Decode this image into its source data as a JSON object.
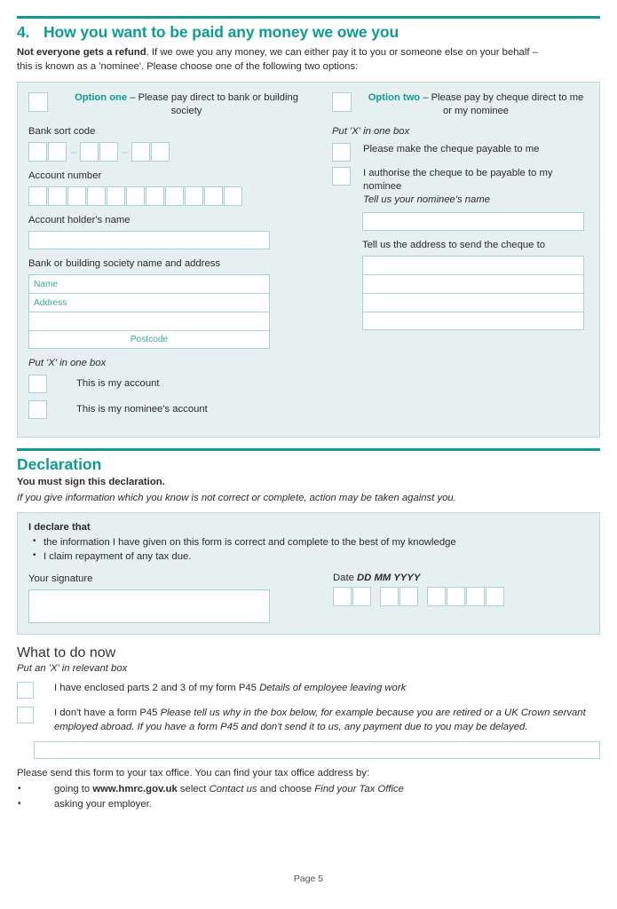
{
  "section4": {
    "number": "4.",
    "title": "How you want to be paid any money we owe you",
    "intro_bold": "Not everyone gets a refund",
    "intro_rest": ". If we owe you any money, we can either pay it to you or someone else on your behalf – this is known as a 'nominee'. Please choose one of the following two options:",
    "option_one": {
      "name": "Option one",
      "desc": "– Please pay direct to bank or building society",
      "sort_code_label": "Bank sort code",
      "sort_code_boxes": 6,
      "sort_code_separator": "–",
      "account_number_label": "Account number",
      "account_number_boxes": 11,
      "account_holder_label": "Account holder's name",
      "bank_address_label": "Bank or building society name and address",
      "bank_address_rows": [
        "Name",
        "Address",
        "",
        "Postcode"
      ],
      "put_x_label": "Put 'X' in one box",
      "checkbox_my_account": "This is my account",
      "checkbox_nominee_account": "This is my nominee's account"
    },
    "option_two": {
      "name": "Option two",
      "desc": "– Please pay by cheque direct to me or my nominee",
      "put_x_label": "Put 'X' in one box",
      "checkbox_payable_me": "Please make the cheque payable to me",
      "checkbox_payable_nominee": "I authorise the cheque to be payable to my nominee",
      "nominee_name_label": "Tell us your nominee's name",
      "cheque_address_label": "Tell us the address to send the cheque to",
      "cheque_address_rows": [
        "",
        "",
        "",
        ""
      ]
    }
  },
  "declaration": {
    "title": "Declaration",
    "must_sign": "You must sign this declaration.",
    "warning": "If you give information which you know is not correct or complete, action may be taken against you.",
    "declare_title": "I declare that",
    "bullets": [
      "the information I have given on this form is correct and complete to the best of my knowledge",
      "I claim repayment of any tax due."
    ],
    "signature_label": "Your signature",
    "date_label": "Date",
    "date_format": "DD MM YYYY",
    "date_groups": [
      2,
      2,
      4
    ]
  },
  "what_to_do": {
    "title": "What to do now",
    "put_x_label": "Put an 'X' in relevant box",
    "option_p45_plain": "I have enclosed parts 2 and 3 of my form P45 ",
    "option_p45_italic": "Details of employee leaving work",
    "option_no_p45_plain": "I don't have a form P45 ",
    "option_no_p45_italic": "Please tell us why in the box below, for example because you are retired or a UK Crown servant employed abroad. If you have a form P45 and don't send it to us, any payment due to you may be delayed.",
    "send_intro": "Please send this form to your tax office. You can find your tax office address by:",
    "bullet1_pre": "going to ",
    "bullet1_url": "www.hmrc.gov.uk",
    "bullet1_mid": " select ",
    "bullet1_em1": "Contact us",
    "bullet1_mid2": " and choose ",
    "bullet1_em2": "Find your Tax Office",
    "bullet2": "asking your employer."
  },
  "footer": {
    "page_label": "Page 5"
  },
  "colors": {
    "teal": "#0f9b93",
    "panel_bg": "#e6f0f0",
    "box_border": "#a9d3d3",
    "text": "#2b2b2b"
  }
}
